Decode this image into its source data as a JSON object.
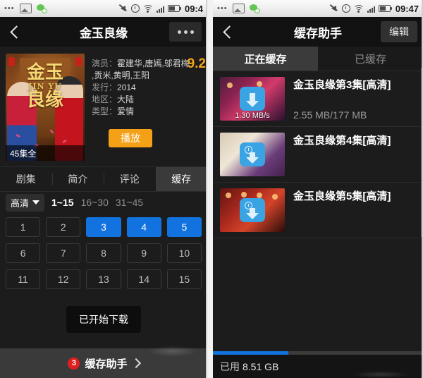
{
  "status_bar": {
    "icons_left": [
      "more-dots-icon",
      "gallery-icon",
      "wechat-icon"
    ],
    "icons_right": [
      "mute-icon",
      "alarm-icon",
      "wifi-icon",
      "signal-icon",
      "battery-icon"
    ],
    "time_left_panel": "09:4",
    "time_right_panel": "09:47"
  },
  "left": {
    "nav": {
      "back_icon": "back-chevron-icon",
      "title": "金玉良缘",
      "more_icon": "more-dots-icon"
    },
    "poster": {
      "title_main": "金玉",
      "title_sub": "良缘",
      "title_tiny": "JIN YU",
      "episode_count": "45集全"
    },
    "meta": {
      "rating": "9.2",
      "cast_label": "演员：",
      "cast_line1": "霍建华,唐嫣,邬君梅",
      "cast_line2": ",贡米,黄明,王阳",
      "release_label": "发行：",
      "release_value": "2014",
      "region_label": "地区：",
      "region_value": "大陆",
      "genre_label": "类型：",
      "genre_value": "爱情"
    },
    "play_button": "播放",
    "tabs": [
      {
        "label": "剧集",
        "active": false
      },
      {
        "label": "简介",
        "active": false
      },
      {
        "label": "评论",
        "active": false
      },
      {
        "label": "缓存",
        "active": true
      }
    ],
    "quality": "高清",
    "ranges": [
      {
        "label": "1~15",
        "active": true
      },
      {
        "label": "16~30",
        "active": false
      },
      {
        "label": "31~45",
        "active": false
      }
    ],
    "episodes": [
      {
        "n": "1",
        "selected": false
      },
      {
        "n": "2",
        "selected": false
      },
      {
        "n": "3",
        "selected": true
      },
      {
        "n": "4",
        "selected": true
      },
      {
        "n": "5",
        "selected": true
      },
      {
        "n": "6",
        "selected": false
      },
      {
        "n": "7",
        "selected": false
      },
      {
        "n": "8",
        "selected": false
      },
      {
        "n": "9",
        "selected": false
      },
      {
        "n": "10",
        "selected": false
      },
      {
        "n": "11",
        "selected": false
      },
      {
        "n": "12",
        "selected": false
      },
      {
        "n": "13",
        "selected": false
      },
      {
        "n": "14",
        "selected": false
      },
      {
        "n": "15",
        "selected": false
      }
    ],
    "toast": "已开始下载",
    "bottom_bar": {
      "badge": "3",
      "label": "缓存助手",
      "chevron_icon": "chevron-right-icon"
    }
  },
  "right": {
    "nav": {
      "back_icon": "back-chevron-icon",
      "title": "缓存助手",
      "edit_label": "编辑"
    },
    "segments": [
      {
        "label": "正在缓存",
        "active": true
      },
      {
        "label": "已缓存",
        "active": false
      }
    ],
    "downloads": [
      {
        "title": "金玉良缘第3集[高清]",
        "speed": "1.30 MB/s",
        "progress_text": "2.55 MB/177 MB",
        "state_icon": "download-arrow-icon"
      },
      {
        "title": "金玉良缘第4集[高清]",
        "speed": "",
        "progress_text": "",
        "state_icon": "download-pending-icon"
      },
      {
        "title": "金玉良缘第5集[高清]",
        "speed": "",
        "progress_text": "",
        "state_icon": "download-pending-icon"
      }
    ],
    "storage": {
      "used_label": "已用",
      "used_value": "8.51 GB",
      "used_percent": 36
    }
  },
  "colors": {
    "accent_blue": "#1273e0",
    "accent_orange": "#f5a118",
    "badge_red": "#e02020",
    "panel_bg": "#1c1c1c"
  }
}
